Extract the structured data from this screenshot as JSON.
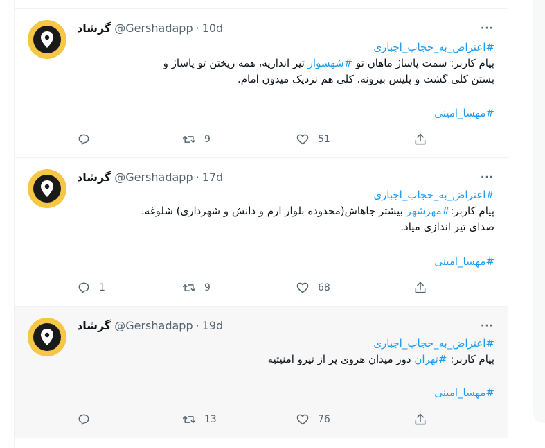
{
  "tweets": [
    {
      "name": "گرشاد",
      "handle": "@Gershadapp",
      "sep": "·",
      "time": "10d",
      "more": "···",
      "hashtag_top": "#اعتراض_به_حجاب_اجباری",
      "line1_pre": "پیام کاربر: سمت پاساژ ماهان تو ",
      "line1_tag": "#شهسوار",
      "line1_post": " تیر اندازیه، همه ریختن تو پاساژ و",
      "line2": "بستن کلی گشت و پلیس بیرونه. کلی هم نزدیک میدون امام.",
      "hashtag_bottom": "#مهسا_امینی",
      "reply_count": "",
      "retweet_count": "9",
      "like_count": "51"
    },
    {
      "name": "گرشاد",
      "handle": "@Gershadapp",
      "sep": "·",
      "time": "17d",
      "more": "···",
      "hashtag_top": "#اعتراض_به_حجاب_اجباری",
      "line1_pre": "پیام کاربر:",
      "line1_tag": "#مهرشهر",
      "line1_post": " بیشتر جاهاش(محدوده بلوار ارم و دانش و شهرداری) شلوغه.",
      "line2": "صدای تیر اندازی میاد.",
      "hashtag_bottom": "#مهسا_امینی",
      "reply_count": "1",
      "retweet_count": "9",
      "like_count": "68"
    },
    {
      "name": "گرشاد",
      "handle": "@Gershadapp",
      "sep": "·",
      "time": "19d",
      "more": "···",
      "hashtag_top": "#اعتراض_به_حجاب_اجباری",
      "line1_pre": "پیام کاربر: ",
      "line1_tag": "#تهران",
      "line1_post": " دور میدان هروی پر از نیرو امنیتیه",
      "line2": "",
      "hashtag_bottom": "#مهسا_امینی",
      "reply_count": "",
      "retweet_count": "13",
      "like_count": "76"
    }
  ],
  "icons": {
    "avatar": "map-pin-icon",
    "reply": "reply-icon",
    "retweet": "retweet-icon",
    "like": "heart-icon",
    "share": "share-icon"
  },
  "colors": {
    "accent": "#1d9bf0",
    "avatar_bg": "#f6c744",
    "muted": "#536471"
  }
}
